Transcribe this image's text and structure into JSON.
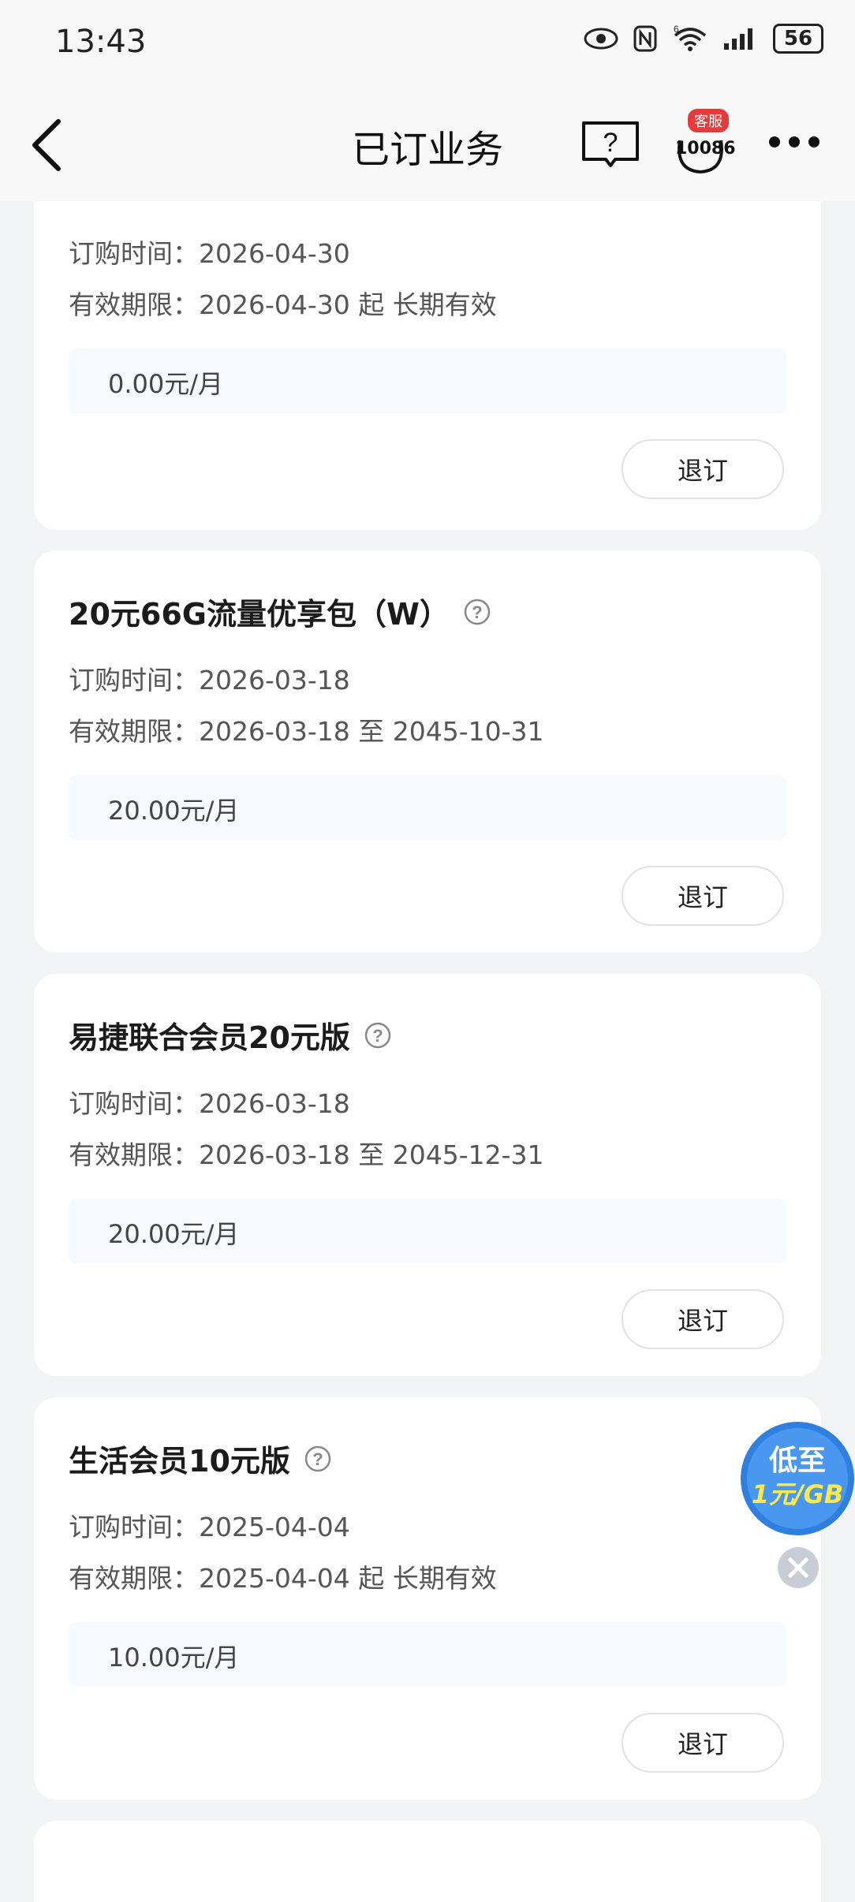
{
  "status_bar": {
    "time": "13:43",
    "battery": "56",
    "network": "6"
  },
  "nav": {
    "title": "已订业务",
    "help_icon": "question-book-icon",
    "cs_badge": "客服",
    "cs_number": "10086",
    "more_icon": "more-dots-icon"
  },
  "labels": {
    "order_time": "订购时间：",
    "validity": "有效期限：",
    "unsubscribe": "退订"
  },
  "services": [
    {
      "name": "",
      "order_time": "2026-04-30",
      "validity": "2026-04-30 起 长期有效",
      "price": "0.00元/月"
    },
    {
      "name": "20元66G流量优享包（W）",
      "order_time": "2026-03-18",
      "validity": "2026-03-18 至  2045-10-31",
      "price": "20.00元/月"
    },
    {
      "name": "易捷联合会员20元版",
      "order_time": "2026-03-18",
      "validity": "2026-03-18 至  2045-12-31",
      "price": "20.00元/月"
    },
    {
      "name": "生活会员10元版",
      "order_time": "2025-04-04",
      "validity": "2025-04-04 起 长期有效",
      "price": "10.00元/月"
    }
  ],
  "float_ad": {
    "line1": "低至",
    "line2": "1元/GB"
  },
  "colors": {
    "accent_blue": "#2f7fe0",
    "badge_red": "#e63b3b",
    "price_bg": "#f6f9fd",
    "page_bg": "#f3f4f6"
  }
}
